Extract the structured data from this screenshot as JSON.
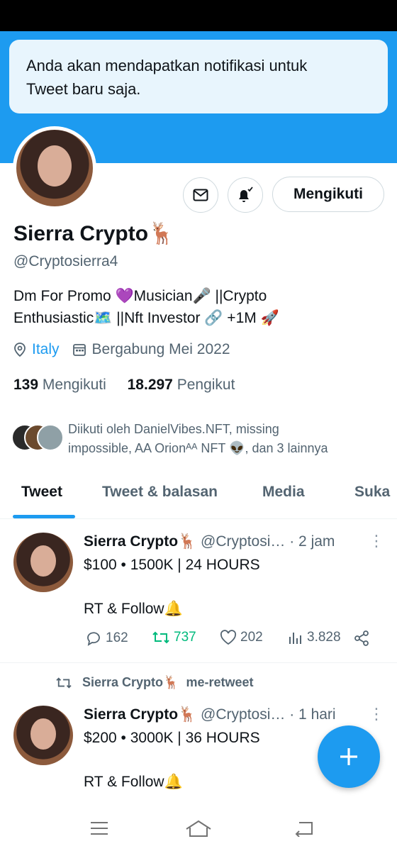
{
  "toast": {
    "line1": "Anda akan mendapatkan notifikasi untuk",
    "line2": "Tweet baru saja."
  },
  "profile": {
    "name": "Sierra Crypto",
    "name_emoji": "🦌",
    "handle": "@Cryptosierra4",
    "bio_line1": "Dm For Promo 💜Musician🎤 ||Crypto",
    "bio_line2": "Enthusiastic🗺️  ||Nft Investor 🔗 +1M 🚀",
    "location": "Italy",
    "joined": "Bergabung Mei 2022",
    "following_count": "139",
    "following_label": "Mengikuti",
    "followers_count": "18.297",
    "followers_label": "Pengikut",
    "follow_button": "Mengikuti"
  },
  "mutuals": {
    "line1": "Diikuti oleh DanielVibes.NFT, missing",
    "line2": "impossible, AA Orionᴬᴬ NFT 👽, dan 3 lainnya"
  },
  "tabs": [
    {
      "label": "Tweet",
      "active": true
    },
    {
      "label": "Tweet & balasan",
      "active": false
    },
    {
      "label": "Media",
      "active": false
    },
    {
      "label": "Suka",
      "active": false
    }
  ],
  "tweets": [
    {
      "author": "Sierra Crypto",
      "emoji": "🦌",
      "handle": "@Cryptosi…",
      "time": "· 2 jam",
      "line1": "$100 • 1500K | 24 HOURS",
      "line2": "RT & Follow🔔",
      "replies": "162",
      "retweets": "737",
      "likes": "202",
      "views": "3.828"
    },
    {
      "retweet_note_name": "Sierra Crypto🦌",
      "retweet_note_suffix": "me-retweet",
      "author": "Sierra Crypto",
      "emoji": "🦌",
      "handle": "@Cryptosi…",
      "time": "· 1 hari",
      "line1": "$200 • 3000K | 36 HOURS",
      "line2": "RT & Follow🔔"
    }
  ],
  "colors": {
    "accent": "#1d9bf0",
    "retweet_active": "#00ba7c",
    "secondary_text": "#536471"
  }
}
